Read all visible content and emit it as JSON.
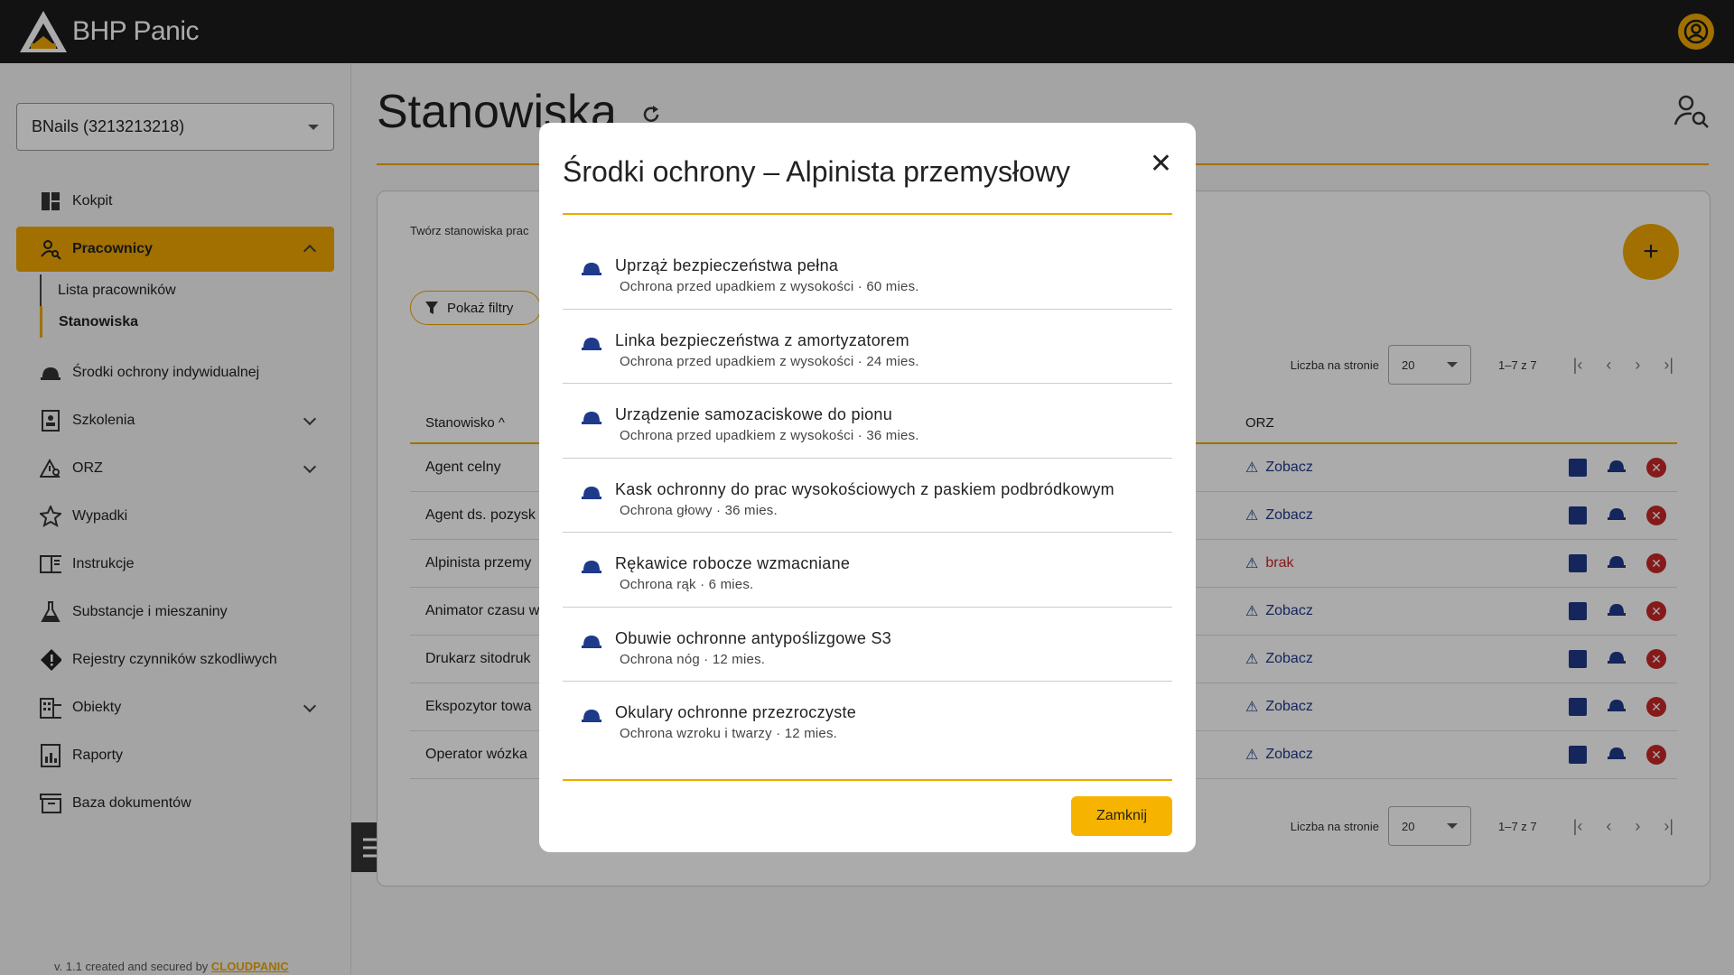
{
  "app": {
    "name": "BHP Panic"
  },
  "sidebar": {
    "company": "BNails (3213213218)",
    "items": [
      {
        "label": "Kokpit"
      },
      {
        "label": "Pracownicy"
      },
      {
        "label": "Środki ochrony indywidualnej"
      },
      {
        "label": "Szkolenia"
      },
      {
        "label": "ORZ"
      },
      {
        "label": "Wypadki"
      },
      {
        "label": "Instrukcje"
      },
      {
        "label": "Substancje i mieszaniny"
      },
      {
        "label": "Rejestry czynników szkodliwych"
      },
      {
        "label": "Obiekty"
      },
      {
        "label": "Raporty"
      },
      {
        "label": "Baza dokumentów"
      }
    ],
    "sub": {
      "list": "Lista pracowników",
      "positions": "Stanowiska"
    },
    "footer_prefix": "v. 1.1 created and secured by ",
    "footer_brand": "CLOUDPANIC"
  },
  "main": {
    "title": "Stanowiska",
    "description": "Twórz stanowiska prac",
    "filter_button": "Pokaż filtry",
    "pager": {
      "label": "Liczba na stronie",
      "size": "20",
      "range": "1–7 z 7"
    },
    "columns": {
      "position": "Stanowisko",
      "orz": "ORZ"
    },
    "rows": [
      {
        "name": "Agent celny",
        "orz": "Zobacz"
      },
      {
        "name": "Agent ds. pozysk",
        "orz": "Zobacz"
      },
      {
        "name": "Alpinista przemy",
        "orz": "brak"
      },
      {
        "name": "Animator czasu w",
        "orz": "Zobacz"
      },
      {
        "name": "Drukarz sitodruk",
        "orz": "Zobacz"
      },
      {
        "name": "Ekspozytor towa",
        "orz": "Zobacz"
      },
      {
        "name": "Operator wózka",
        "orz": "Zobacz"
      }
    ]
  },
  "modal": {
    "title": "Środki ochrony – Alpinista przemysłowy",
    "close_button": "Zamknij",
    "items": [
      {
        "name": "Uprząż bezpieczeństwa pełna",
        "desc": "Ochrona przed upadkiem z wysokości · 60 mies."
      },
      {
        "name": "Linka bezpieczeństwa z amortyzatorem",
        "desc": "Ochrona przed upadkiem z wysokości · 24 mies."
      },
      {
        "name": "Urządzenie samozaciskowe do pionu",
        "desc": "Ochrona przed upadkiem z wysokości · 36 mies."
      },
      {
        "name": "Kask ochronny do prac wysokościowych z paskiem podbródkowym",
        "desc": "Ochrona głowy · 36 mies."
      },
      {
        "name": "Rękawice robocze wzmacniane",
        "desc": "Ochrona rąk · 6 mies."
      },
      {
        "name": "Obuwie ochronne antypoślizgowe S3",
        "desc": "Ochrona nóg · 12 mies."
      },
      {
        "name": "Okulary ochronne przezroczyste",
        "desc": "Ochrona wzroku i twarzy · 12 mies."
      }
    ]
  },
  "colors": {
    "accent": "#f0a800",
    "dark": "#1c1c1c",
    "link": "#1e3a8a",
    "danger": "#c62828"
  }
}
